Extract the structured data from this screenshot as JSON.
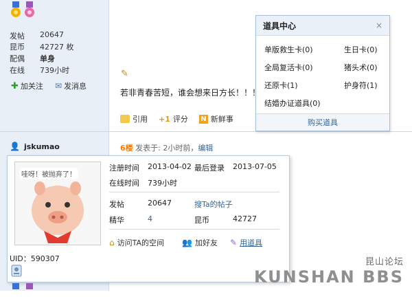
{
  "user1": {
    "stats": [
      {
        "label": "发帖",
        "value": "20647"
      },
      {
        "label": "昆币",
        "value": "42727 枚"
      },
      {
        "label": "配偶",
        "value": "单身"
      },
      {
        "label": "在线",
        "value": "739小时"
      }
    ],
    "add_follow": "加关注",
    "send_message": "发消息"
  },
  "post": {
    "text": "若非青春苦短，谁会想来日方长！！！（",
    "actions": {
      "quote": "引用",
      "rate": "评分",
      "news": "新鲜事"
    }
  },
  "props_popup": {
    "title": "道具中心",
    "close": "×",
    "items": [
      {
        "name": "单版救生卡(0)"
      },
      {
        "name": "生日卡(0)"
      },
      {
        "name": "全局复活卡(0)"
      },
      {
        "name": "猪头术(0)"
      },
      {
        "name": "还原卡(1)"
      },
      {
        "name": "护身符(1)"
      },
      {
        "name": "结婚办证道具(0)"
      }
    ],
    "buy": "购买道具"
  },
  "user2": {
    "username": "jskumao",
    "floor": "6楼",
    "posted": "发表于: 2小时前，",
    "edit": "编辑",
    "uid": "UID：590307"
  },
  "profile_popup": {
    "avatar_text": "哇呀！被抛弃了！",
    "reg_label": "注册时间",
    "reg_date": "2013-04-02",
    "last_login_label": "最后登录",
    "last_login_date": "2013-07-05",
    "online_label": "在线时间",
    "online_value": "739小时",
    "posts_label": "发帖",
    "posts_value": "20647",
    "search_posts": "搜Ta的帖子",
    "elite_label": "精华",
    "elite_value": "4",
    "coin_label": "昆币",
    "coin_value": "42727",
    "visit_space": "访问TA的空间",
    "add_friend": "加好友",
    "use_prop": "用道具"
  },
  "watermark": {
    "cn": "昆山论坛",
    "en": "KUNSHAN BBS"
  }
}
